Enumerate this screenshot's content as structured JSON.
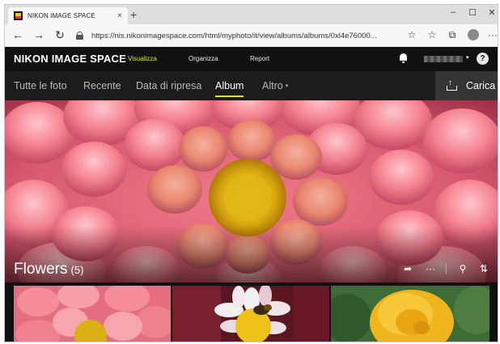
{
  "browser": {
    "tab_title": "NIKON IMAGE SPACE",
    "tab_close": "×",
    "new_tab": "+",
    "minimize": "–",
    "maximize": "☐",
    "close": "✕",
    "back": "←",
    "forward": "→",
    "reload": "↻",
    "url": "https://nis.nikonimagespace.com/html/myphoto/it/view/albums/albums/0xl4e76000...",
    "favorite_icon": "☆",
    "favorites_bar_icon": "☆",
    "collections_icon": "⧉",
    "menu_icon": "···"
  },
  "header": {
    "logo": "NIKON IMAGE SPACE",
    "nav": [
      "Visualizza",
      "Organizza",
      "Report"
    ],
    "active_nav": "Visualizza",
    "help_label": "?",
    "caret": "▾"
  },
  "subnav": {
    "items": [
      "Tutte le foto",
      "Recente",
      "Data di ripresa",
      "Album",
      "Altro"
    ],
    "active": "Album",
    "more_caret": "▾",
    "upload_label": "Carica"
  },
  "album": {
    "name": "Flowers",
    "count": "(5)",
    "share_icon": "➦",
    "more_icon": "···",
    "location_icon": "⚲",
    "sort_icon": "⇅"
  },
  "colors": {
    "accent": "#d8e33b",
    "header_bg": "#111111",
    "subnav_bg": "#1c1c1c"
  }
}
